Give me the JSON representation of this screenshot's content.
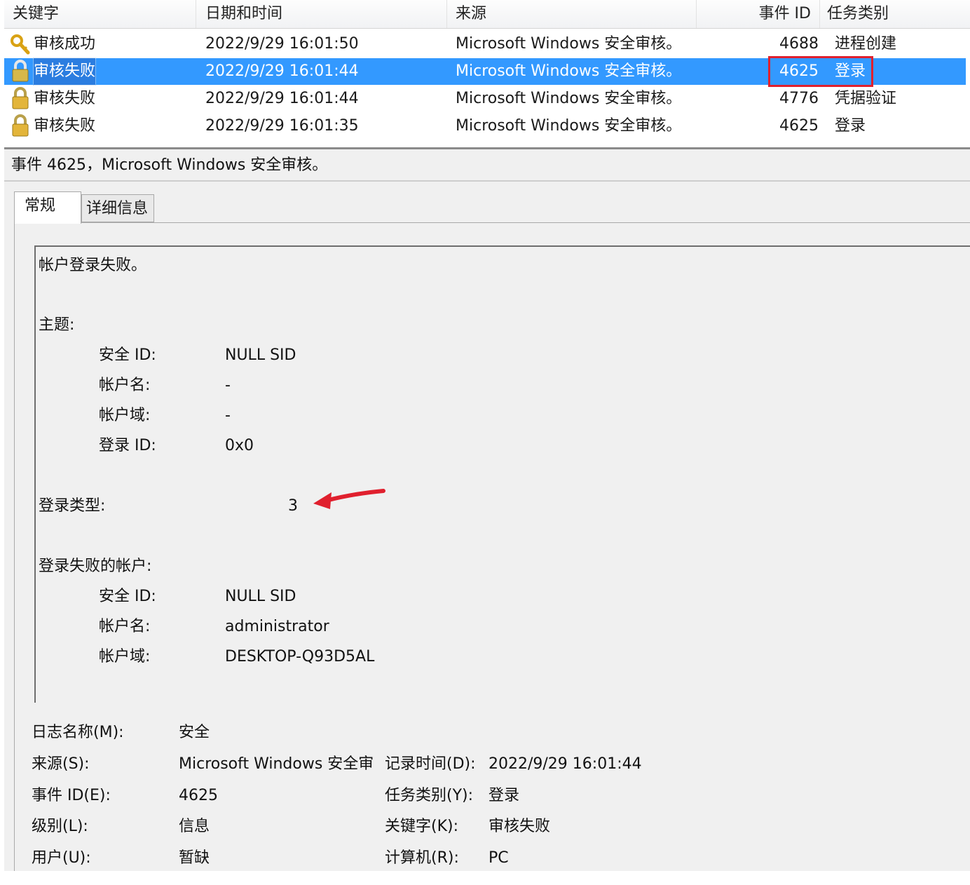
{
  "list": {
    "columns": {
      "keyword": "关键字",
      "datetime": "日期和时间",
      "source": "来源",
      "event_id": "事件 ID",
      "task": "任务类别"
    },
    "rows": [
      {
        "icon": "key-icon",
        "keyword": "审核成功",
        "datetime": "2022/9/29 16:01:50",
        "source": "Microsoft Windows 安全审核。",
        "event_id": "4688",
        "task": "进程创建",
        "selected": false
      },
      {
        "icon": "lock-icon",
        "keyword": "审核失败",
        "datetime": "2022/9/29 16:01:44",
        "source": "Microsoft Windows 安全审核。",
        "event_id": "4625",
        "task": "登录",
        "selected": true
      },
      {
        "icon": "lock-icon",
        "keyword": "审核失败",
        "datetime": "2022/9/29 16:01:44",
        "source": "Microsoft Windows 安全审核。",
        "event_id": "4776",
        "task": "凭据验证",
        "selected": false
      },
      {
        "icon": "lock-icon",
        "keyword": "审核失败",
        "datetime": "2022/9/29 16:01:35",
        "source": "Microsoft Windows 安全审核。",
        "event_id": "4625",
        "task": "登录",
        "selected": false
      }
    ]
  },
  "detail": {
    "title": "事件 4625，Microsoft Windows 安全审核。",
    "tabs": [
      "常规",
      "详细信息"
    ],
    "description": {
      "heading": "帐户登录失败。",
      "subject_label": "主题:",
      "subject": {
        "security_id_label": "安全 ID:",
        "security_id": "NULL SID",
        "account_name_label": "帐户名:",
        "account_name": "-",
        "account_domain_label": "帐户域:",
        "account_domain": "-",
        "logon_id_label": "登录 ID:",
        "logon_id": "0x0"
      },
      "logon_type_label": "登录类型:",
      "logon_type": "3",
      "failed_account_label": "登录失败的帐户:",
      "failed_account": {
        "security_id_label": "安全 ID:",
        "security_id": "NULL SID",
        "account_name_label": "帐户名:",
        "account_name": "administrator",
        "account_domain_label": "帐户域:",
        "account_domain": "DESKTOP-Q93D5AL"
      }
    },
    "properties": {
      "log_name_label": "日志名称(M):",
      "log_name": "安全",
      "source_label": "来源(S):",
      "source": "Microsoft Windows 安全审",
      "logged_label": "记录时间(D):",
      "logged": "2022/9/29 16:01:44",
      "event_id_label": "事件 ID(E):",
      "event_id": "4625",
      "task_label": "任务类别(Y):",
      "task": "登录",
      "level_label": "级别(L):",
      "level": "信息",
      "keywords_label": "关键字(K):",
      "keywords": "审核失败",
      "user_label": "用户(U):",
      "user": "暂缺",
      "computer_label": "计算机(R):",
      "computer": "PC"
    }
  },
  "annotation": {
    "arrow_color": "#e0202e",
    "box_color": "#e0202e",
    "selection_color": "#3399ff"
  }
}
